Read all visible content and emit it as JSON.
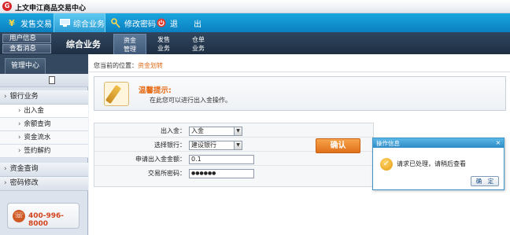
{
  "app": {
    "title": "上文申江商品交易中心"
  },
  "topmenu": {
    "items": [
      {
        "label": "发售交易"
      },
      {
        "label": "综合业务"
      },
      {
        "label": "修改密码"
      },
      {
        "label": "退　　出"
      }
    ]
  },
  "header": {
    "user_info": "用户信息",
    "view_messages": "查看消息",
    "section": "综合业务",
    "tabs": [
      {
        "line1": "资金",
        "line2": "管理"
      },
      {
        "line1": "发售",
        "line2": "业务"
      },
      {
        "line1": "仓单",
        "line2": "业务"
      }
    ]
  },
  "sidebar": {
    "tab": "管理中心",
    "bank_group": "银行业务",
    "bank_items": [
      "出入金",
      "余额查询",
      "资金流水",
      "签约解约"
    ],
    "funds_query": "资金查询",
    "password_change": "密码修改",
    "phone": "400-996-8000"
  },
  "main": {
    "breadcrumb_prefix": "您当前的位置：",
    "breadcrumb_current": "资金划转",
    "tip_title": "温馨提示:",
    "tip_text": "在此您可以进行出入金操作。",
    "form": {
      "direction_label": "出入金：",
      "direction_value": "入金",
      "bank_label": "选择银行：",
      "bank_value": "建设银行",
      "amount_label": "申请出入金金额：",
      "amount_value": "0.1",
      "password_label": "交易所密码：",
      "password_value": "●●●●●●"
    },
    "confirm": "确认"
  },
  "dialog": {
    "title": "操作信息",
    "close": "×",
    "message": "请求已处理，请稍后查看",
    "ok": "确　定"
  }
}
